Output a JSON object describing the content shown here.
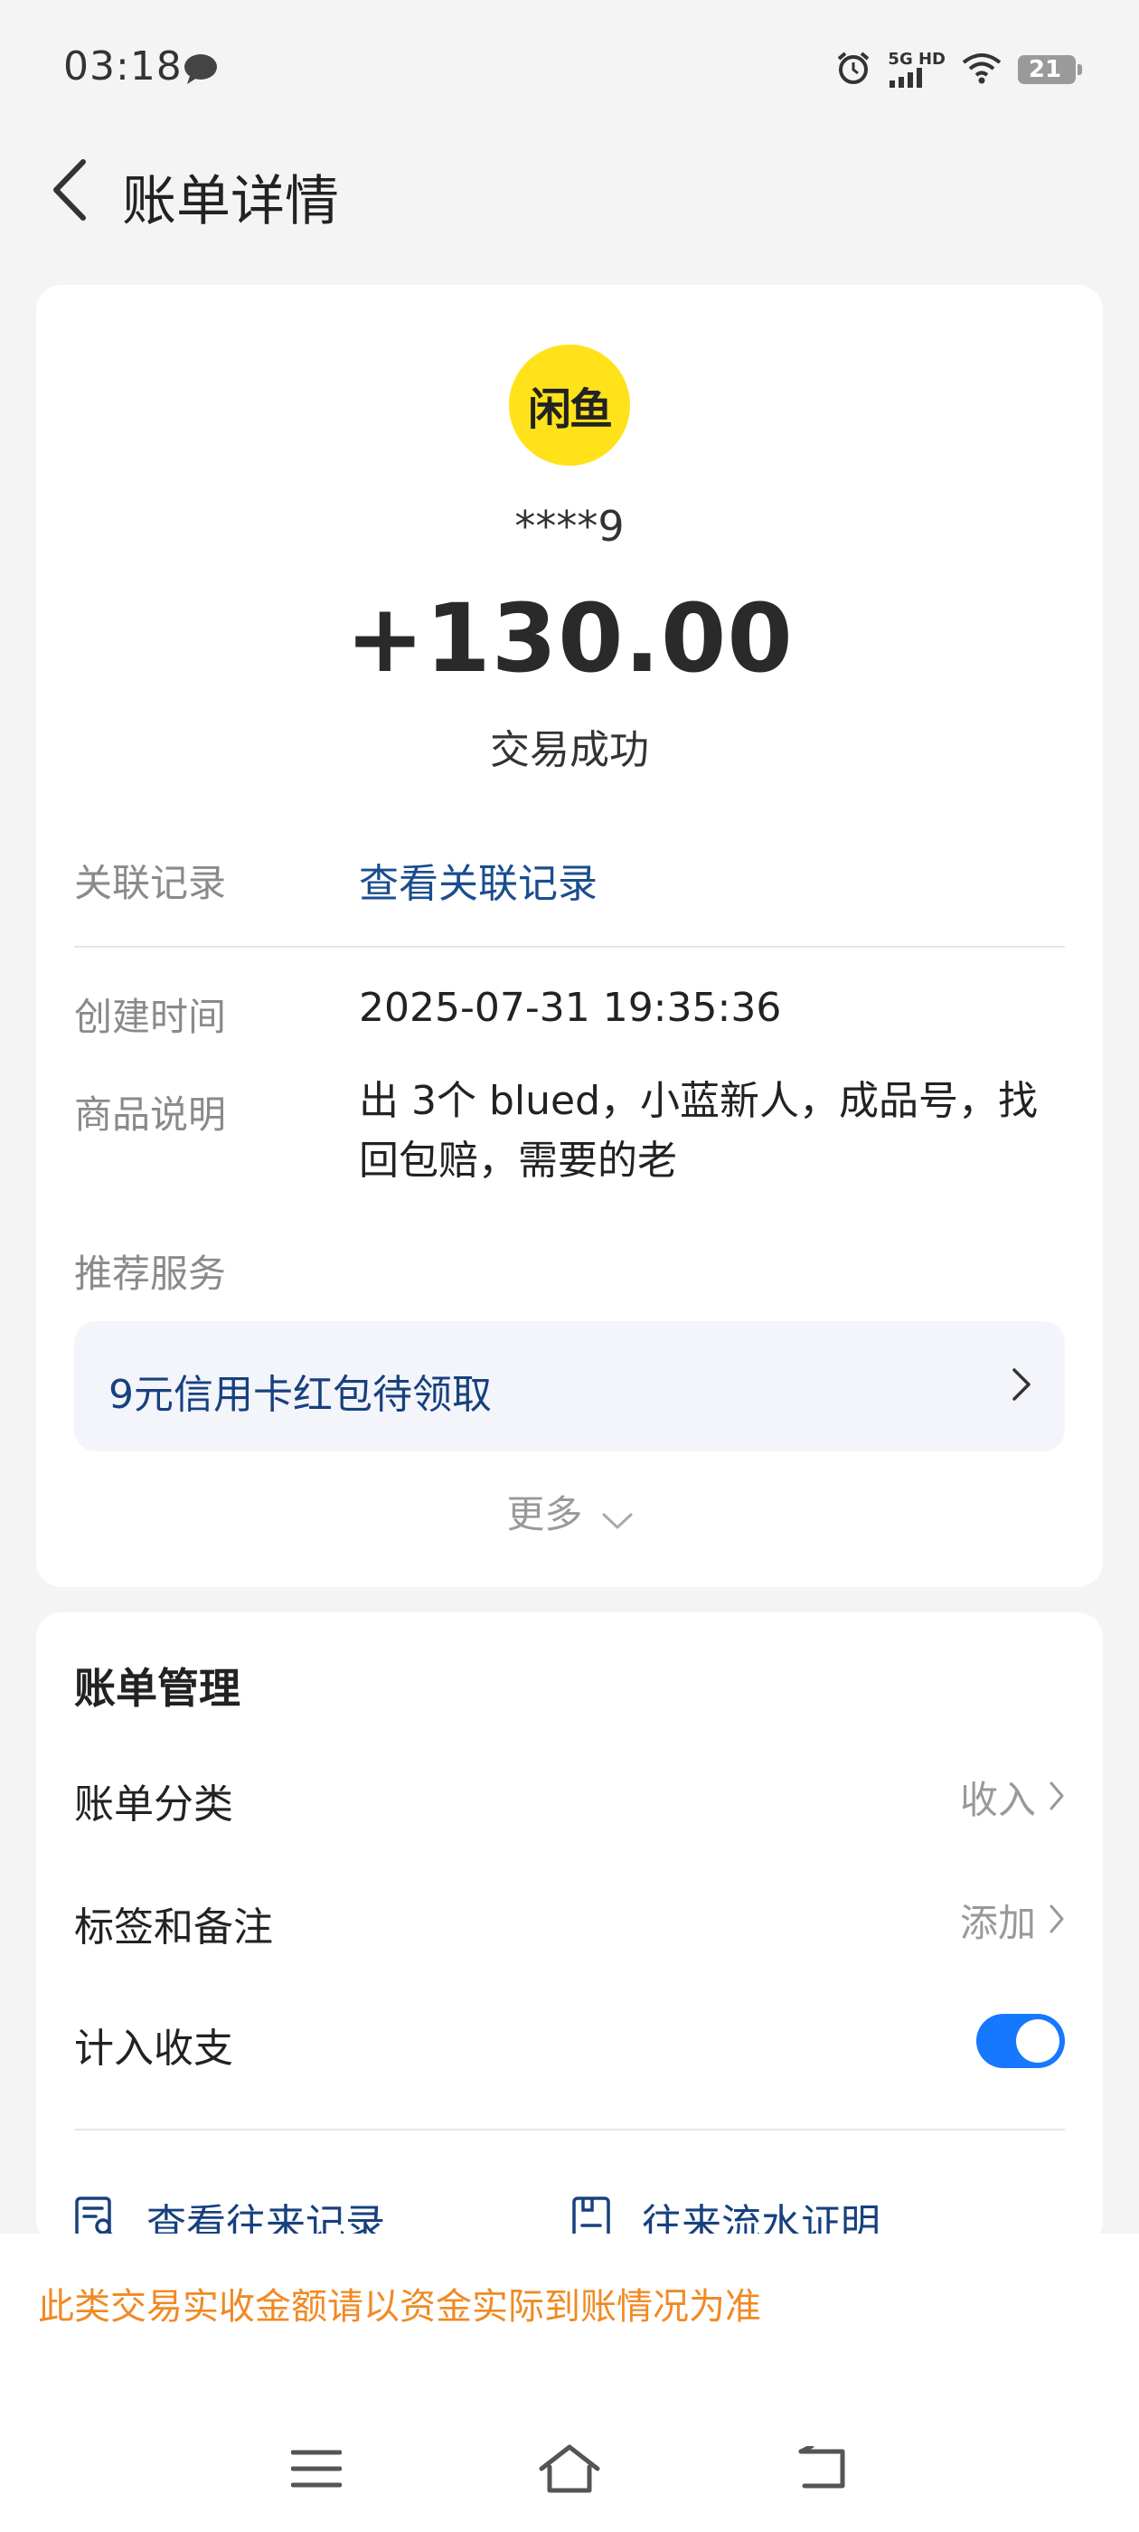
{
  "status_bar": {
    "time": "03:18",
    "network": "5G HD",
    "battery": "21"
  },
  "header": {
    "title": "账单详情"
  },
  "transaction": {
    "merchant_logo_text": "闲鱼",
    "counterparty": "****9",
    "amount": "+130.00",
    "status": "交易成功",
    "related_label": "关联记录",
    "related_link": "查看关联记录",
    "created_label": "创建时间",
    "created_value": "2025-07-31 19:35:36",
    "desc_label": "商品说明",
    "desc_value": "出 3个 blued，小蓝新人，成品号，找回包赔，需要的老",
    "services_label": "推荐服务",
    "promo_text": "9元信用卡红包待领取",
    "more_label": "更多"
  },
  "manage": {
    "title": "账单管理",
    "category_label": "账单分类",
    "category_value": "收入",
    "tags_label": "标签和备注",
    "tags_value": "添加",
    "include_label": "计入收支",
    "include_enabled": true,
    "history_link": "查看往来记录",
    "proof_link": "往来流水证明"
  },
  "notice": {
    "text": "此类交易实收金额请以资金实际到账情况为准"
  },
  "colors": {
    "accent_blue": "#1677ff",
    "link_blue": "#1a4d8f",
    "notice_orange": "#f08a24",
    "logo_yellow": "#ffe21a"
  }
}
